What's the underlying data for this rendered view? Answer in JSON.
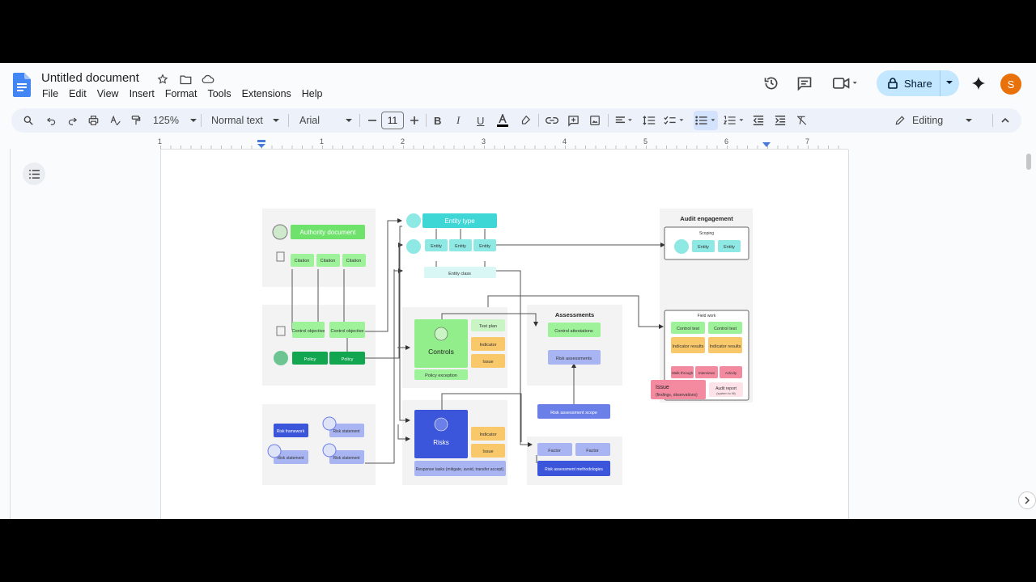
{
  "doc": {
    "title": "Untitled document"
  },
  "menu": [
    "File",
    "Edit",
    "View",
    "Insert",
    "Format",
    "Tools",
    "Extensions",
    "Help"
  ],
  "toolbar": {
    "zoom": "125%",
    "style": "Normal text",
    "font": "Arial",
    "font_size": "11",
    "mode": "Editing"
  },
  "share": {
    "label": "Share"
  },
  "avatar": {
    "initial": "S",
    "color": "#e8710a"
  },
  "ruler": {
    "ticks": [
      "1",
      "1",
      "2",
      "3",
      "4",
      "5",
      "6",
      "7"
    ]
  },
  "diagram": {
    "authority_document": "Authority document",
    "citation": "Citation",
    "control_objective": "Control objective",
    "policy": "Policy",
    "risk_framework": "Risk framework",
    "risk_statement": "Risk statement",
    "entity_type": "Entity type",
    "entity": "Entity",
    "entity_class": "Entity class",
    "controls": "Controls",
    "test_plan": "Test plan",
    "indicator": "Indicator",
    "issue": "Issue",
    "policy_exception": "Policy exception",
    "risks": "Risks",
    "response_tasks": "Response tasks (mitigate, avoid, transfer accept)",
    "assessments": "Assessments",
    "control_attestations": "Control attestations",
    "risk_assessments": "Risk assessments",
    "risk_assessment_scope": "Risk assessment scope",
    "factor": "Factor",
    "risk_assessment_methodologies": "Risk assessment methodologies",
    "audit_engagement": "Audit engagement",
    "scoping": "Scoping",
    "field_work": "Field work",
    "control_test": "Control test",
    "indicator_results": "Indicator results",
    "walk_through": "Walk through",
    "interviews": "Interviews",
    "activity": "Activity",
    "issue_findings": "Issue",
    "issue_findings_sub": "(findings, observations)",
    "audit_report": "Audit report",
    "audit_report_sub": "(system to fill)"
  },
  "colors": {
    "green_light": "#9df29a",
    "green_bright": "#6ee26a",
    "green_dark": "#12a650",
    "teal": "#3fd6d6",
    "teal_light": "#8ee8e4",
    "controls_green": "#92ee8b",
    "orange": "#f9c86b",
    "blue_dark": "#3b55db",
    "blue_mid": "#6b7fe8",
    "blue_light": "#a9b4f3",
    "pink": "#f38aa0",
    "panel": "#f2f2f2"
  }
}
